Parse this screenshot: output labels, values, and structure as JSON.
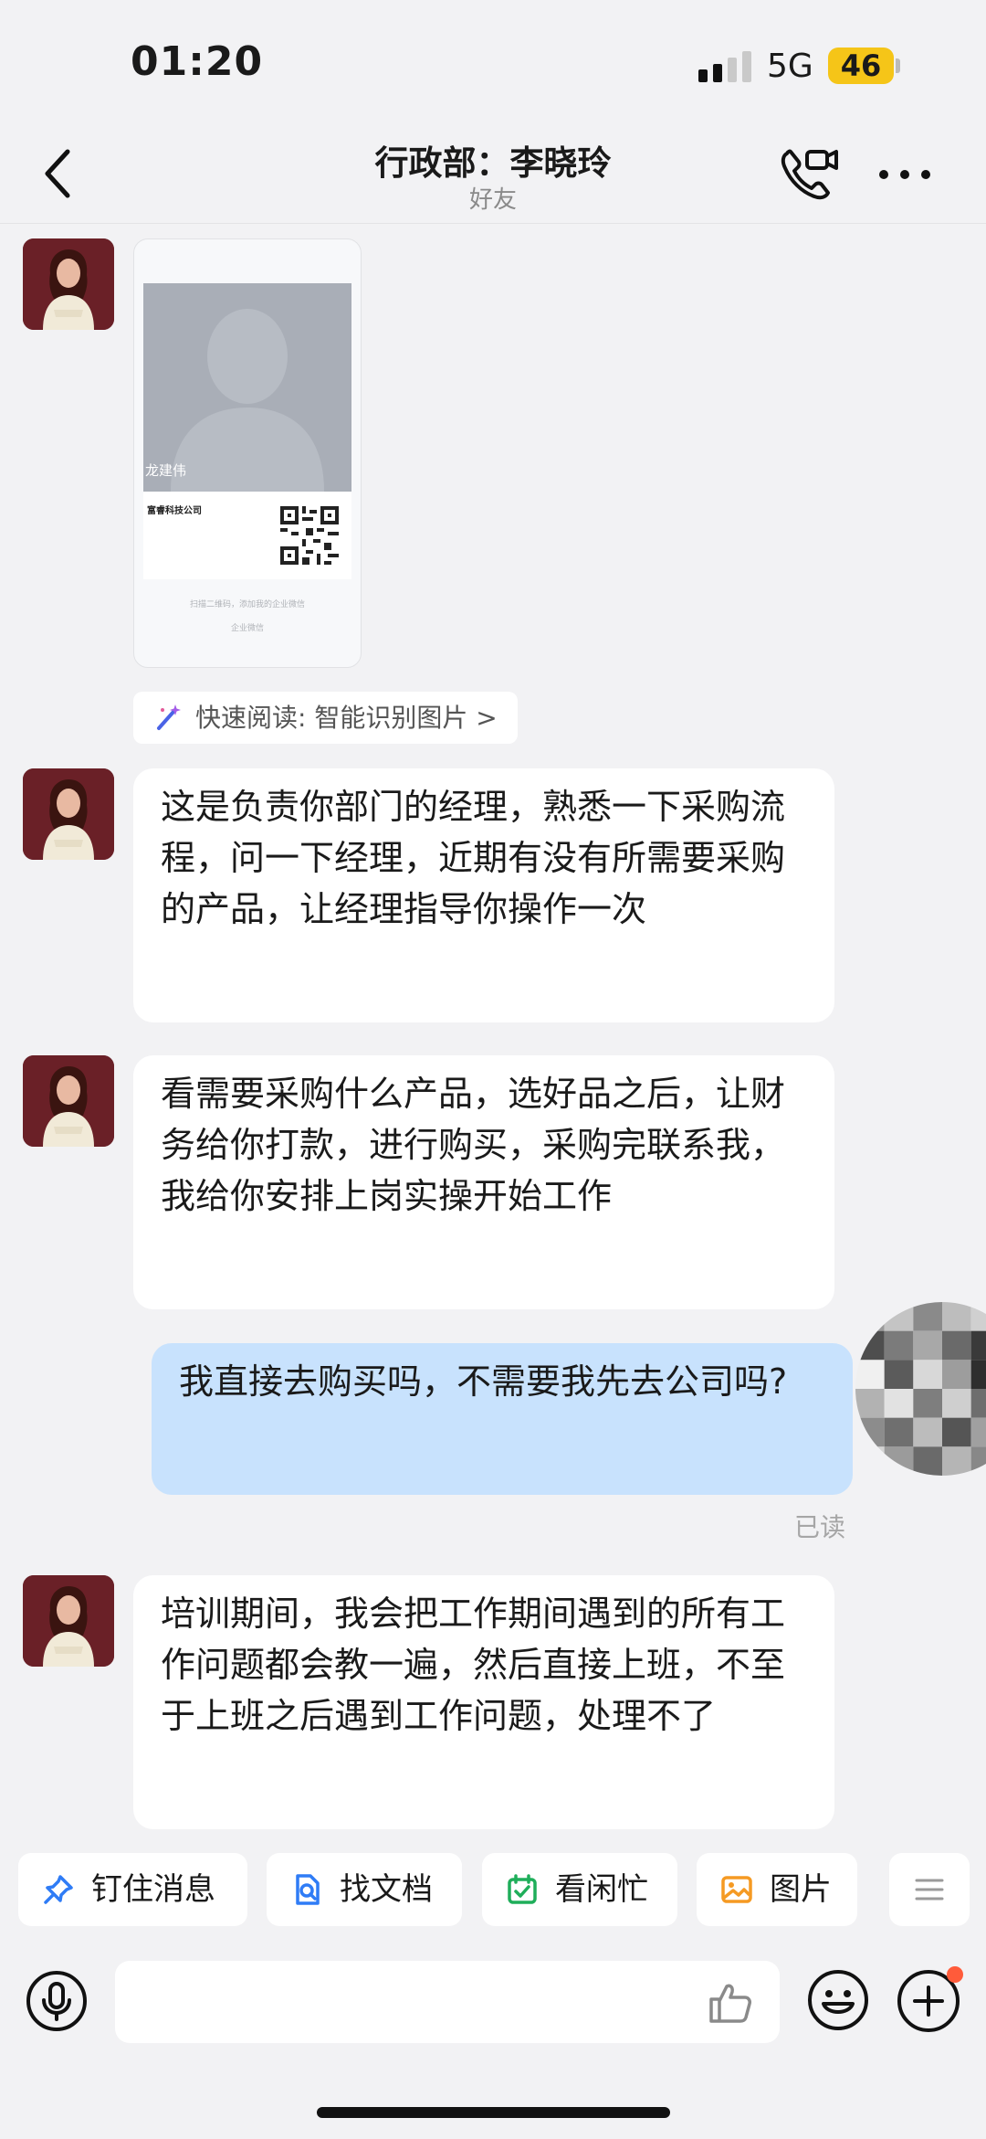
{
  "status": {
    "time": "01:20",
    "network": "5G",
    "battery": "46"
  },
  "header": {
    "title": "行政部：李晓玲",
    "subtitle": "好友"
  },
  "card": {
    "name": "龙建伟",
    "company": "富睿科技公司",
    "hint": "扫描二维码，添加我的企业微信",
    "footer": "企业微信"
  },
  "quick_read": "快速阅读: 智能识别图片 >",
  "messages": [
    {
      "from": "other",
      "text": "这是负责你部门的经理，熟悉一下采购流程，问一下经理，近期有没有所需要采购的产品，让经理指导你操作一次"
    },
    {
      "from": "other",
      "text": "看需要采购什么产品，选好品之后，让财务给你打款，进行购买，采购完联系我，我给你安排上岗实操开始工作"
    },
    {
      "from": "me",
      "text": "我直接去购买吗，不需要我先去公司吗?"
    },
    {
      "from": "other",
      "text": "培训期间，我会把工作期间遇到的所有工作问题都会教一遍，然后直接上班，不至于上班之后遇到工作问题，处理不了"
    }
  ],
  "read_label": "已读",
  "quick_actions": [
    {
      "label": "钉住消息",
      "icon": "pin-icon",
      "color": "#2f7cf6"
    },
    {
      "label": "找文档",
      "icon": "doc-search-icon",
      "color": "#2f7cf6"
    },
    {
      "label": "看闲忙",
      "icon": "calendar-check-icon",
      "color": "#1fae5a"
    },
    {
      "label": "图片",
      "icon": "image-icon",
      "color": "#f59a23"
    }
  ]
}
